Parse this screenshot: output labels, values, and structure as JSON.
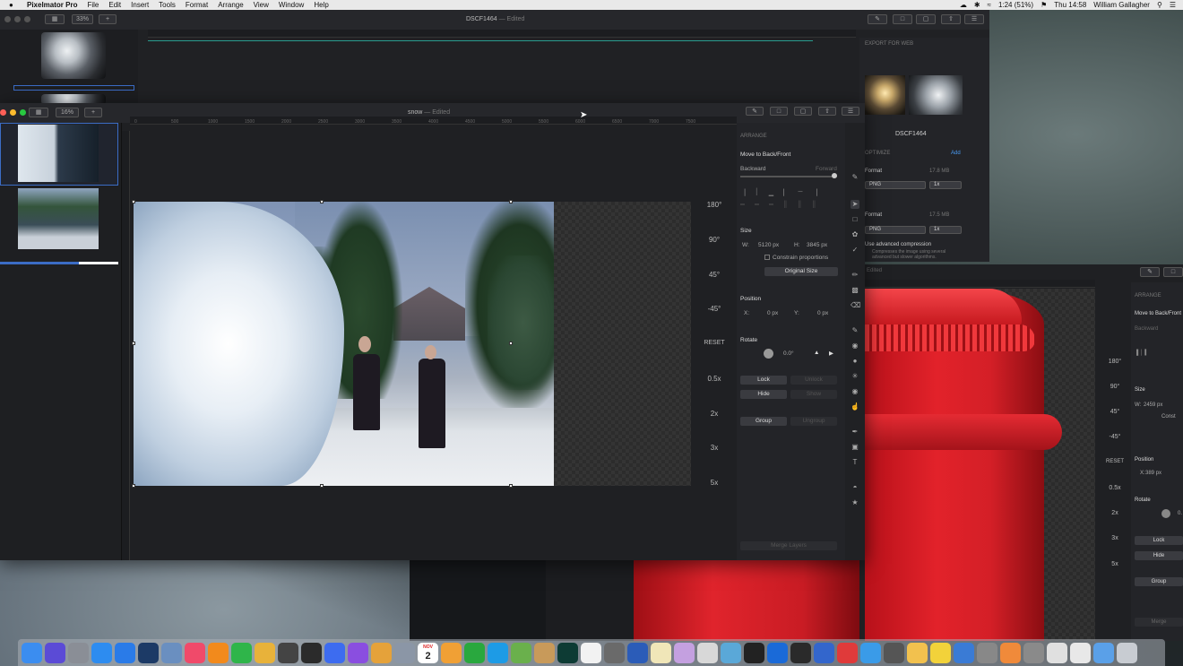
{
  "menubar": {
    "app": "Pixelmator Pro",
    "items": [
      "File",
      "Edit",
      "Insert",
      "Tools",
      "Format",
      "Arrange",
      "View",
      "Window",
      "Help"
    ],
    "battery": "1:24 (51%)",
    "clock": "Thu 14:58",
    "user": "William Gallagher"
  },
  "back_window": {
    "zoom": "33%",
    "doc_title": "DSCF1464",
    "doc_status": "Edited"
  },
  "export_panel": {
    "header": "EXPORT FOR WEB",
    "name": "DSCF1464",
    "optimize": "OPTIMIZE",
    "add": "Add",
    "format1_label": "Format",
    "format1_size": "17.8 MB",
    "format1_value": "PNG",
    "scale1": "1x",
    "format2_label": "Format",
    "format2_size": "17.5 MB",
    "format2_value": "PNG",
    "scale2": "1x",
    "compression_label": "Use advanced compression",
    "compression_note": "Compresses the image using several advanced but slower algorithms."
  },
  "main_window": {
    "zoom": "16%",
    "doc_title": "snow",
    "doc_status": "Edited",
    "ruler_marks": [
      "0",
      "500",
      "1000",
      "1500",
      "2000",
      "2500",
      "3000",
      "3500",
      "4000",
      "4500",
      "5000",
      "5500",
      "6000",
      "6500",
      "7000",
      "7500"
    ]
  },
  "rotate_strip": [
    "180°",
    "90°",
    "45°",
    "-45°",
    "RESET",
    "0.5x",
    "2x",
    "3x",
    "5x"
  ],
  "inspector": {
    "section": "ARRANGE",
    "move_to": "Move to Back/Front",
    "backward": "Backward",
    "forward": "Forward",
    "size_label": "Size",
    "w_label": "W:",
    "w_value": "5120 px",
    "h_label": "H:",
    "h_value": "3845 px",
    "constrain": "Constrain proportions",
    "original_size": "Original Size",
    "position_label": "Position",
    "x_label": "X:",
    "x_value": "0 px",
    "y_label": "Y:",
    "y_value": "0 px",
    "rotate_label": "Rotate",
    "rotate_value": "0.0°",
    "lock": "Lock",
    "unlock": "Unlock",
    "hide": "Hide",
    "show": "Show",
    "group": "Group",
    "ungroup": "Ungroup",
    "merge": "Merge Layers"
  },
  "right_window": {
    "status": "Edited",
    "section": "ARRANGE",
    "move_to": "Move to Back/Front",
    "backward": "Backward",
    "size_label": "Size",
    "w_label": "W:",
    "w_value": "2459 px",
    "constrain": "Const",
    "position_label": "Position",
    "x_label": "X:",
    "x_value": "389 px",
    "rotate_label": "Rotate",
    "rotate_value": "0.",
    "lock": "Lock",
    "hide": "Hide",
    "group": "Group",
    "merge": "Merge",
    "rotate_strip": [
      "180°",
      "90°",
      "45°",
      "-45°",
      "RESET",
      "0.5x",
      "2x",
      "3x",
      "5x"
    ]
  },
  "dock": {
    "calendar_month": "NOV",
    "calendar_day": "2",
    "apps": [
      {
        "icon": "finder-icon",
        "color": "#3b8df0"
      },
      {
        "icon": "siri-icon",
        "color": "#5b4bd6"
      },
      {
        "icon": "launchpad-icon",
        "color": "#8a8e96"
      },
      {
        "icon": "app-store-icon",
        "color": "#2d8cf0"
      },
      {
        "icon": "safari-icon",
        "color": "#2a7be8"
      },
      {
        "icon": "quicktime-icon",
        "color": "#1c3a66"
      },
      {
        "icon": "preview-icon",
        "color": "#6a8fc0"
      },
      {
        "icon": "music-icon",
        "color": "#f04a6a"
      },
      {
        "icon": "books-icon",
        "color": "#f28a1c"
      },
      {
        "icon": "facetime-icon",
        "color": "#2fb54a"
      },
      {
        "icon": "butterfly-icon",
        "color": "#e8b23a"
      },
      {
        "icon": "scrivener-icon",
        "color": "#444444"
      },
      {
        "icon": "s-app-icon",
        "color": "#2b2b2b"
      },
      {
        "icon": "vectorize-icon",
        "color": "#3d6cf0"
      },
      {
        "icon": "check-icon",
        "color": "#8a4ee0"
      },
      {
        "icon": "notes-icon",
        "color": "#e5a23a"
      },
      {
        "icon": "scanner-icon",
        "color": "#8b96a6"
      },
      {
        "icon": "calendar-icon",
        "color": "#ffffff"
      },
      {
        "icon": "pages-icon",
        "color": "#f0a035"
      },
      {
        "icon": "numbers-icon",
        "color": "#29a83e"
      },
      {
        "icon": "skype-icon",
        "color": "#1d9be6"
      },
      {
        "icon": "maps-icon",
        "color": "#6ab04c"
      },
      {
        "icon": "bottle-icon",
        "color": "#c89a5a"
      },
      {
        "icon": "audition-icon",
        "color": "#0d3b34"
      },
      {
        "icon": "pixelmator-icon",
        "color": "#f2f2f2"
      },
      {
        "icon": "scrivener-s-icon",
        "color": "#6a6a6a"
      },
      {
        "icon": "word-icon",
        "color": "#2b5cb8"
      },
      {
        "icon": "notepad-icon",
        "color": "#f0e6b8"
      },
      {
        "icon": "star-icon",
        "color": "#c4a0e0"
      },
      {
        "icon": "script-icon",
        "color": "#d8d8d8"
      },
      {
        "icon": "bird-icon",
        "color": "#5aa8d8"
      },
      {
        "icon": "plex-icon",
        "color": "#222222"
      },
      {
        "icon": "1password-icon",
        "color": "#1a6ad8"
      },
      {
        "icon": "terminal-icon",
        "color": "#2a2a2a"
      },
      {
        "icon": "istat-icon",
        "color": "#3366cc"
      },
      {
        "icon": "k-icon",
        "color": "#e03a3a"
      },
      {
        "icon": "pixel-icon",
        "color": "#3a9be8"
      },
      {
        "icon": "gear-icon",
        "color": "#555555"
      },
      {
        "icon": "hand-icon",
        "color": "#f2c14e"
      },
      {
        "icon": "sticky-icon",
        "color": "#f2d23a"
      },
      {
        "icon": "sketch-icon",
        "color": "#3a7bd5"
      },
      {
        "icon": "m-icon",
        "color": "#888888"
      },
      {
        "icon": "photos-icon",
        "color": "#f08a3a"
      },
      {
        "icon": "system-prefs-icon",
        "color": "#8a8a8a"
      },
      {
        "icon": "pixelmator-pro-icon",
        "color": "#e0e0e0"
      },
      {
        "icon": "document-icon",
        "color": "#e8e8e8"
      },
      {
        "icon": "folder-icon",
        "color": "#5aa0e8"
      },
      {
        "icon": "trash-icon",
        "color": "#c8ccd2"
      }
    ]
  }
}
